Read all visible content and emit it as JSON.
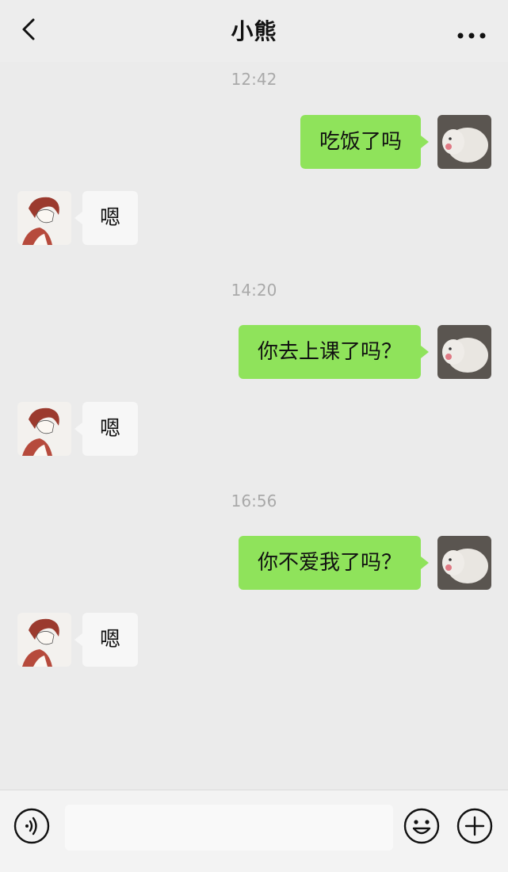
{
  "header": {
    "title": "小熊"
  },
  "messages": [
    {
      "time": "12:42",
      "me": "吃饭了吗",
      "them": "嗯"
    },
    {
      "time": "14:20",
      "me": "你去上课了吗？",
      "them": "嗯"
    },
    {
      "time": "16:56",
      "me": "你不爱我了吗？",
      "them": "嗯"
    }
  ],
  "colors": {
    "my_bubble": "#8fe35b",
    "their_bubble": "#f7f7f7",
    "background": "#ebebeb"
  },
  "icons": {
    "back": "chevron-left-icon",
    "more": "more-dots-icon",
    "voice": "voice-icon",
    "emoji": "emoji-icon",
    "add": "plus-icon"
  }
}
